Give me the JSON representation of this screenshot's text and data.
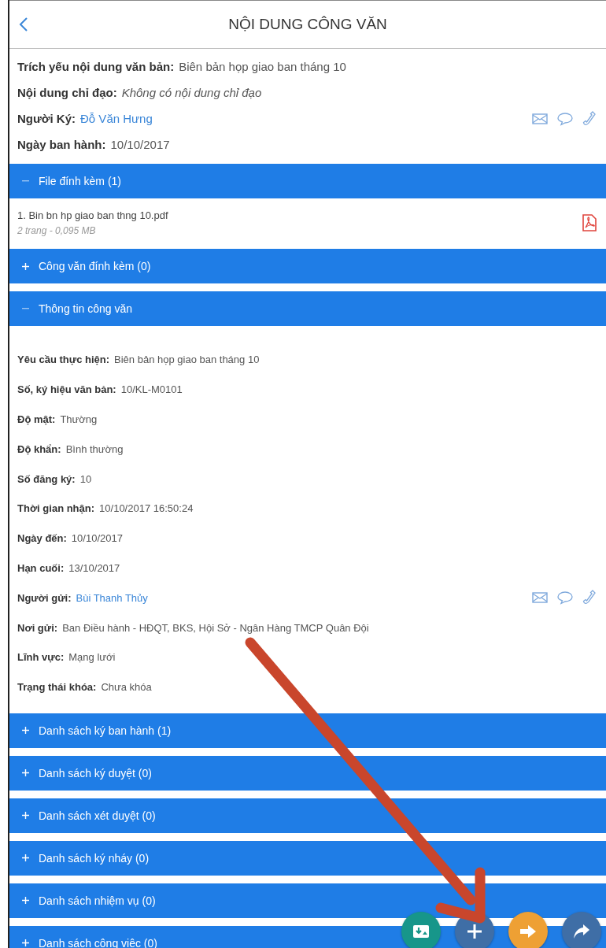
{
  "header": {
    "title": "NỘI DUNG CÔNG VĂN"
  },
  "summary": [
    {
      "label": "Trích yếu nội dung văn bản:",
      "value": "Biên bản họp giao ban tháng 10",
      "kind": "plain"
    },
    {
      "label": "Nội dung chỉ đạo:",
      "value": "Không có nội dung chỉ đạo",
      "kind": "note"
    },
    {
      "label": "Người Ký:",
      "value": "Đỗ Văn Hưng",
      "kind": "person"
    },
    {
      "label": "Ngày ban hành:",
      "value": "10/10/2017",
      "kind": "plain"
    }
  ],
  "sections": [
    {
      "title": "File đính kèm (1)",
      "expanded": true,
      "files": [
        {
          "name": "1. Bin bn hp giao ban thng 10.pdf",
          "meta": "2 trang - 0,095 MB"
        }
      ]
    },
    {
      "title": "Công văn đính kèm (0)",
      "expanded": false
    },
    {
      "title": "Thông tin công văn",
      "expanded": true,
      "fields": [
        {
          "label": "Yêu cầu thực hiện:",
          "value": "Biên bản họp giao ban tháng 10",
          "kind": "plain"
        },
        {
          "label": "Số, ký hiệu văn bản:",
          "value": "10/KL-M0101",
          "kind": "plain"
        },
        {
          "label": "Độ mật:",
          "value": "Thường",
          "kind": "plain"
        },
        {
          "label": "Độ khẩn:",
          "value": "Bình thường",
          "kind": "plain"
        },
        {
          "label": "Số đăng ký:",
          "value": "10",
          "kind": "plain"
        },
        {
          "label": "Thời gian nhận:",
          "value": "10/10/2017 16:50:24",
          "kind": "plain"
        },
        {
          "label": "Ngày đến:",
          "value": "10/10/2017",
          "kind": "plain"
        },
        {
          "label": "Hạn cuối:",
          "value": "13/10/2017",
          "kind": "plain"
        },
        {
          "label": "Người gửi:",
          "value": "Bùi Thanh Thủy",
          "kind": "person"
        },
        {
          "label": "Nơi gửi:",
          "value": "Ban Điều hành - HĐQT, BKS, Hội Sở - Ngân Hàng TMCP Quân Đội",
          "kind": "plain"
        },
        {
          "label": "Lĩnh vực:",
          "value": "Mạng lưới",
          "kind": "plain"
        },
        {
          "label": "Trạng thái khóa:",
          "value": "Chưa khóa",
          "kind": "plain"
        }
      ]
    },
    {
      "title": "Danh sách ký ban hành (1)",
      "expanded": false
    },
    {
      "title": "Danh sách ký duyệt (0)",
      "expanded": false
    },
    {
      "title": "Danh sách xét duyệt (0)",
      "expanded": false
    },
    {
      "title": "Danh sách ký nháy (0)",
      "expanded": false
    },
    {
      "title": "Danh sách nhiệm vụ (0)",
      "expanded": false
    },
    {
      "title": "Danh sách công việc (0)",
      "expanded": false
    }
  ],
  "fab": [
    {
      "kind": "upload",
      "color": "#17968a"
    },
    {
      "kind": "add",
      "color": "#3f6ea6"
    },
    {
      "kind": "forward",
      "color": "#eea034"
    },
    {
      "kind": "share",
      "color": "#3f6ea6"
    }
  ]
}
